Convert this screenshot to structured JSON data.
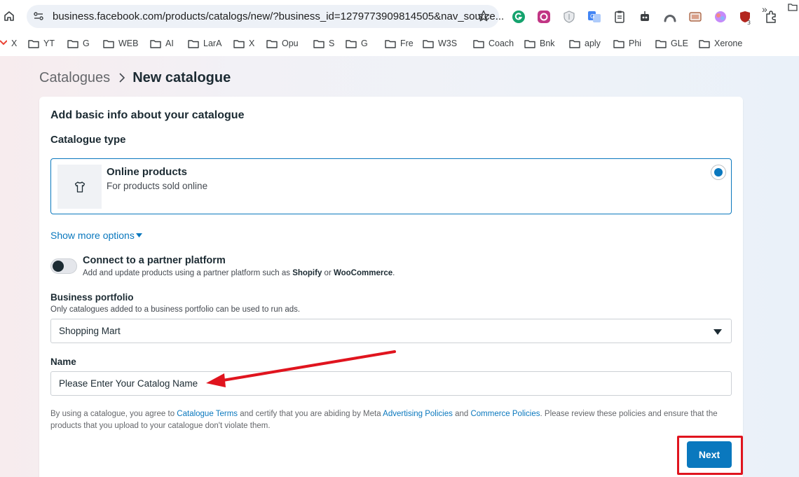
{
  "browser": {
    "url": "business.facebook.com/products/catalogs/new/?business_id=1279773909814505&nav_source...",
    "bookmarks": [
      "X",
      "YT",
      "G",
      "WEB",
      "AI",
      "LarA",
      "X",
      "Opu",
      "S",
      "G",
      "Fre",
      "W3S",
      "Coach",
      "Bnk",
      "aply",
      "Phi",
      "GLE",
      "Xerone"
    ],
    "more_bookmarks": "»",
    "extension_badge": "3"
  },
  "breadcrumb": {
    "parent": "Catalogues",
    "current": "New catalogue"
  },
  "form": {
    "heading": "Add basic info about your catalogue",
    "catalogue_type_label": "Catalogue type",
    "option": {
      "title": "Online products",
      "description": "For products sold online",
      "selected": true
    },
    "show_more": "Show more options",
    "partner": {
      "title": "Connect to a partner platform",
      "desc_prefix": "Add and update products using a partner platform such as ",
      "shopify": "Shopify",
      "or": " or ",
      "woocommerce": "WooCommerce",
      "period": ".",
      "enabled": false
    },
    "portfolio": {
      "label": "Business portfolio",
      "description": "Only catalogues added to a business portfolio can be used to run ads.",
      "selected": "Shopping Mart"
    },
    "name": {
      "label": "Name",
      "value": "Please Enter Your Catalog Name"
    },
    "terms": {
      "t1": "By using a catalogue, you agree to ",
      "link1": "Catalogue Terms",
      "t2": " and certify that you are abiding by Meta ",
      "link2": "Advertising Policies",
      "t3": " and ",
      "link3": "Commerce Policies",
      "t4": ". Please review these policies and ensure that the products that you upload to your catalogue don't violate them."
    },
    "next_label": "Next"
  },
  "colors": {
    "accent": "#0a78be",
    "annotation": "#e0141e"
  }
}
